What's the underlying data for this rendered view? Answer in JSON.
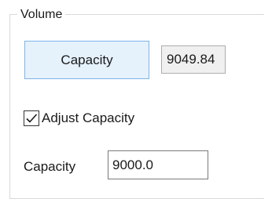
{
  "group": {
    "title": "Volume"
  },
  "capacity_button": {
    "label": "Capacity"
  },
  "computed_capacity": {
    "value": "9049.84"
  },
  "adjust_capacity": {
    "label": "Adjust Capacity",
    "checked": true
  },
  "capacity_field": {
    "label": "Capacity",
    "value": "9000.0"
  },
  "colors": {
    "button_bg": "#e5f1fb",
    "button_border": "#7eb4ea",
    "readonly_bg": "#f0f0f0",
    "group_border": "#d9d9d9"
  }
}
